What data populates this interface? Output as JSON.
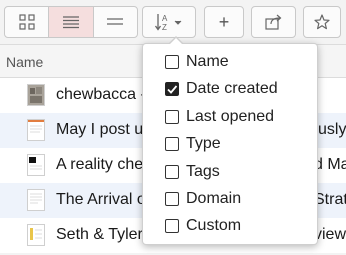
{
  "toolbar": {
    "view_buttons": [
      {
        "icon": "grid-view-icon",
        "active": false
      },
      {
        "icon": "list-view-icon",
        "active": true
      },
      {
        "icon": "compact-list-view-icon",
        "active": false
      }
    ],
    "sort_icon": "sort-alpha-icon",
    "sort_icon_text": "A\nZ",
    "add_label": "+",
    "share_icon": "share-icon",
    "star_icon": "star-icon"
  },
  "header": {
    "name_label": "Name"
  },
  "rows": [
    {
      "title": "chewbacca -"
    },
    {
      "title": "May I post u",
      "trailing": "usly"
    },
    {
      "title": "A reality che",
      "trailing": "d Ma"
    },
    {
      "title": "The Arrival o",
      "trailing": "Strat"
    },
    {
      "title": "Seth & Tyler",
      "trailing": "view"
    }
  ],
  "sort_menu": {
    "options": [
      {
        "label": "Name",
        "checked": false
      },
      {
        "label": "Date created",
        "checked": true
      },
      {
        "label": "Last opened",
        "checked": false
      },
      {
        "label": "Type",
        "checked": false
      },
      {
        "label": "Tags",
        "checked": false
      },
      {
        "label": "Domain",
        "checked": false
      },
      {
        "label": "Custom",
        "checked": false
      }
    ]
  },
  "colors": {
    "active_segment": "#f5dede",
    "row_alt": "#eef3fb",
    "accent_check": "#222222"
  }
}
